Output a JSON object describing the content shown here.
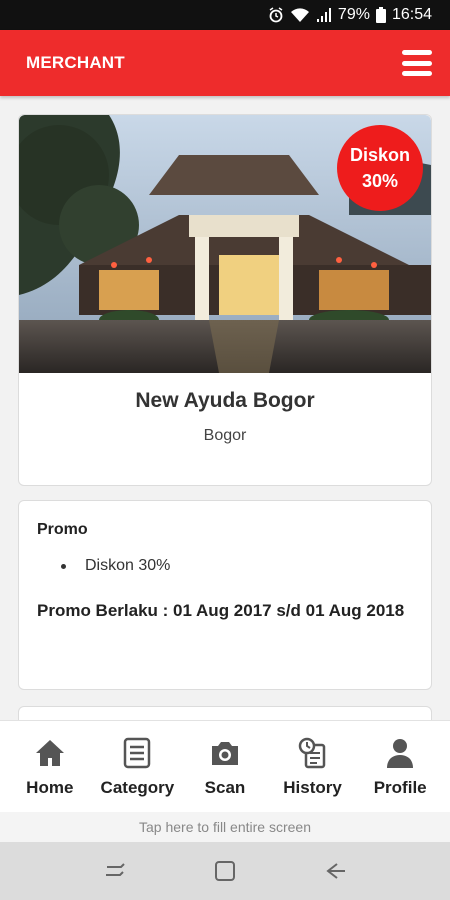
{
  "status_bar": {
    "battery": "79%",
    "time": "16:54"
  },
  "header": {
    "title": "MERCHANT"
  },
  "merchant": {
    "name": "New Ayuda Bogor",
    "city": "Bogor",
    "badge": {
      "line1": "Diskon",
      "line2": "30%"
    }
  },
  "promo": {
    "label": "Promo",
    "items": [
      "Diskon 30%"
    ],
    "validity": "Promo Berlaku : 01 Aug 2017 s/d 01 Aug 2018"
  },
  "nav": {
    "items": [
      {
        "label": "Home",
        "icon": "home-icon"
      },
      {
        "label": "Category",
        "icon": "category-icon"
      },
      {
        "label": "Scan",
        "icon": "camera-icon"
      },
      {
        "label": "History",
        "icon": "history-icon"
      },
      {
        "label": "Profile",
        "icon": "profile-icon"
      }
    ]
  },
  "fill_hint": "Tap here to fill entire screen",
  "colors": {
    "accent": "#ee2c2c",
    "badge": "#ee1c1c"
  }
}
